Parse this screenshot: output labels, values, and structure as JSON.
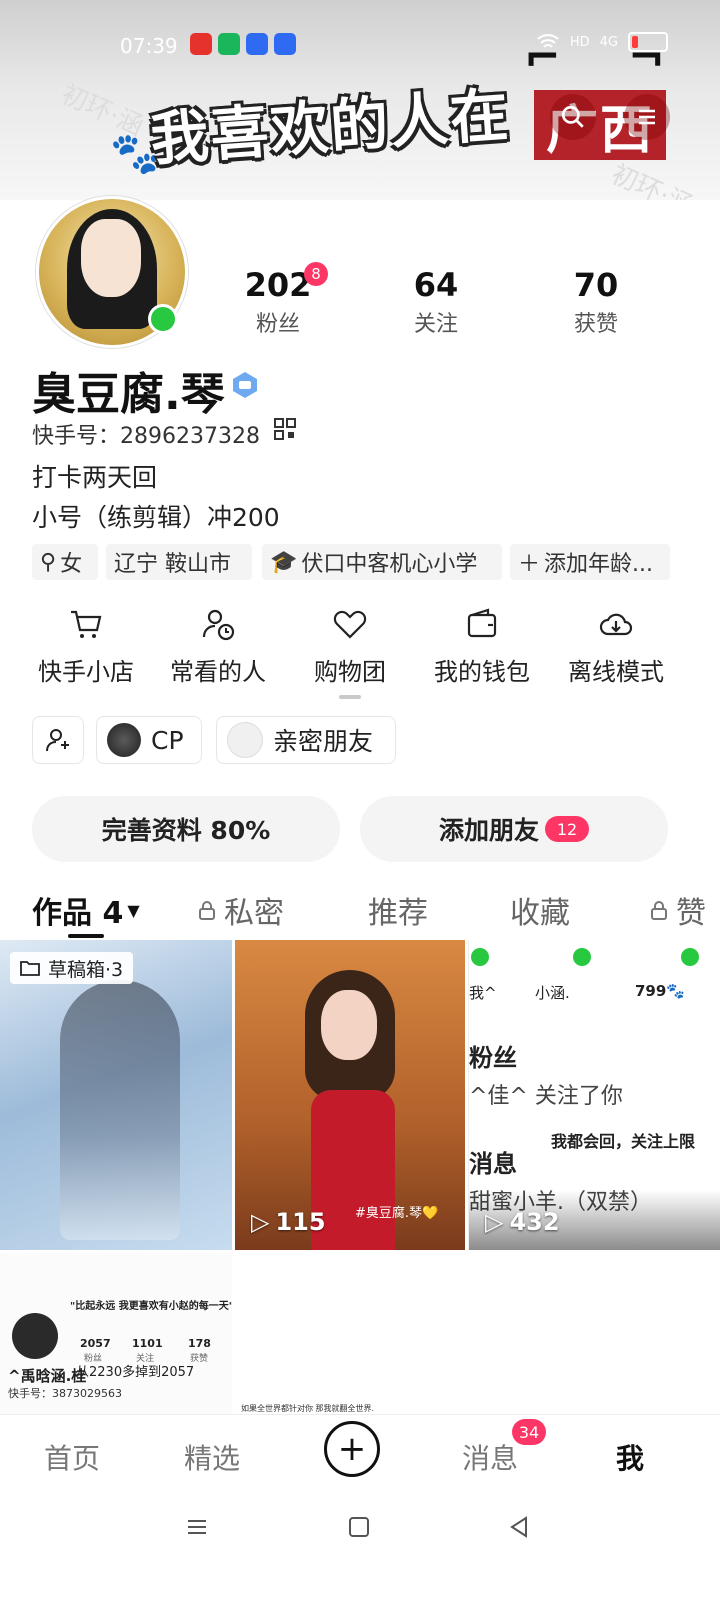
{
  "status_bar": {
    "time": "07:39",
    "network": "4G",
    "hd": "HD",
    "apps": [
      "app-red",
      "app-green",
      "app-blue",
      "app-blue"
    ]
  },
  "banner": {
    "text": "我喜欢的人在",
    "tag": "广西"
  },
  "profile": {
    "stats": [
      {
        "value": "202",
        "label": "粉丝",
        "badge": "8"
      },
      {
        "value": "64",
        "label": "关注"
      },
      {
        "value": "70",
        "label": "获赞"
      }
    ],
    "name": "臭豆腐.琴",
    "kuaishou_id": "快手号：2896237328",
    "bio_lines": [
      "打卡两天回",
      "小号（练剪辑）冲200"
    ],
    "tags": [
      "女",
      "辽宁 鞍山市",
      "伏口中客机心小学",
      "添加年龄..."
    ]
  },
  "functions": [
    "快手小店",
    "常看的人",
    "购物团",
    "我的钱包",
    "离线模式"
  ],
  "chips": {
    "cp": "CP",
    "close_friends": "亲密朋友"
  },
  "actions": {
    "complete_profile": "完善资料 80%",
    "add_friends": "添加朋友",
    "add_friends_badge": "12"
  },
  "tabs": [
    "作品 4",
    "私密",
    "推荐",
    "收藏",
    "赞"
  ],
  "works": [
    {
      "draft_label": "草稿箱·3"
    },
    {
      "play_count": "115",
      "caption": "#臭豆腐.琴💛"
    },
    {
      "play_count": "432",
      "names": [
        "我^",
        "小涵.",
        "799🐾"
      ],
      "section_fans": "粉丝",
      "fans_line": "^佳^ 关注了你",
      "overlay_text": "我都会回，关注上限",
      "section_msgs": "消息",
      "msg_line": "甜蜜小羊.（双禁）"
    },
    {
      "name": "^禹晗涵.桂",
      "quote": "\"比起永远 我更喜欢有小赵的每一天\"",
      "stats": [
        "2057",
        "1101",
        "178"
      ],
      "stat_labels": [
        "粉丝",
        "关注",
        "获赞"
      ],
      "id_line": "快手号：3873029563",
      "handwriting": "从2230多掉到2057"
    },
    {
      "line": "如果全世界都针对你 那我就翻全世界."
    }
  ],
  "nav": {
    "items": [
      "首页",
      "精选",
      "消息",
      "我"
    ],
    "messages_badge": "34"
  }
}
